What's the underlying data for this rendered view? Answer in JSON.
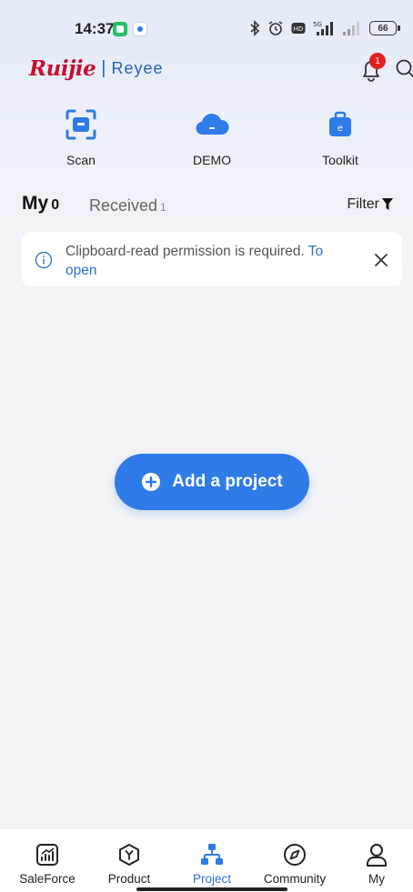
{
  "status_bar": {
    "time": "14:37",
    "battery": "66"
  },
  "header": {
    "brand_primary": "Ruijie",
    "brand_separator": "|",
    "brand_secondary": "Reyee",
    "notification_count": "1"
  },
  "quick_actions": [
    {
      "label": "Scan",
      "icon": "scan-icon"
    },
    {
      "label": "DEMO",
      "icon": "cloud-icon"
    },
    {
      "label": "Toolkit",
      "icon": "toolkit-icon"
    }
  ],
  "tabs": {
    "my_label": "My",
    "my_count": "0",
    "received_label": "Received",
    "received_count": "1",
    "filter_label": "Filter"
  },
  "notice": {
    "message": "Clipboard-read permission is required.",
    "link_text": "To open"
  },
  "main": {
    "add_project_label": "Add a project"
  },
  "bottom_nav": [
    {
      "label": "SaleForce",
      "icon": "saleforce-icon"
    },
    {
      "label": "Product",
      "icon": "product-icon"
    },
    {
      "label": "Project",
      "icon": "project-icon",
      "active": true
    },
    {
      "label": "Community",
      "icon": "compass-icon"
    },
    {
      "label": "My",
      "icon": "user-icon"
    }
  ],
  "colors": {
    "accent": "#2f7be8",
    "brand_red": "#c8102e",
    "brand_blue": "#2a62b8",
    "badge_red": "#e32020"
  }
}
